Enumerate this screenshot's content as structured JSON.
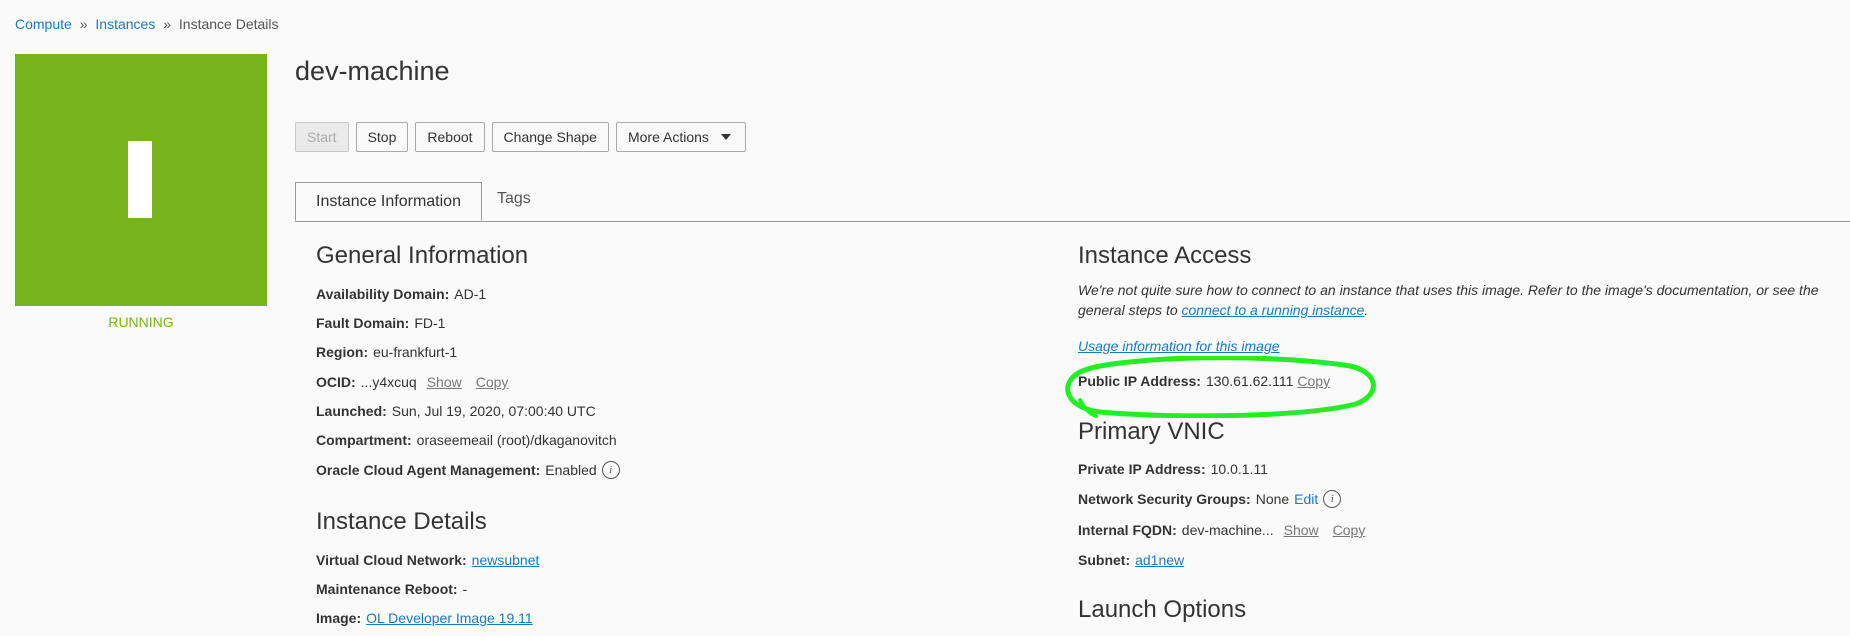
{
  "breadcrumb": {
    "items": [
      "Compute",
      "Instances",
      "Instance Details"
    ],
    "separator": "»"
  },
  "status": {
    "text": "RUNNING",
    "color": "#76b31c"
  },
  "title": "dev-machine",
  "actions": {
    "start": "Start",
    "stop": "Stop",
    "reboot": "Reboot",
    "change_shape": "Change Shape",
    "more_actions": "More Actions"
  },
  "tabs": {
    "instance_information": "Instance Information",
    "tags": "Tags"
  },
  "general": {
    "title": "General Information",
    "availability_domain": {
      "label": "Availability Domain:",
      "value": "AD-1"
    },
    "fault_domain": {
      "label": "Fault Domain:",
      "value": "FD-1"
    },
    "region": {
      "label": "Region:",
      "value": "eu-frankfurt-1"
    },
    "ocid": {
      "label": "OCID:",
      "value": "...y4xcuq",
      "show": "Show",
      "copy": "Copy"
    },
    "launched": {
      "label": "Launched:",
      "value": "Sun, Jul 19, 2020, 07:00:40 UTC"
    },
    "compartment": {
      "label": "Compartment:",
      "value": "oraseemeail (root)/dkaganovitch"
    },
    "agent": {
      "label": "Oracle Cloud Agent Management:",
      "value": "Enabled"
    }
  },
  "details": {
    "title": "Instance Details",
    "vcn": {
      "label": "Virtual Cloud Network:",
      "value": "newsubnet"
    },
    "maintenance": {
      "label": "Maintenance Reboot:",
      "value": "-"
    },
    "image": {
      "label": "Image:",
      "value": "OL Developer Image 19.11"
    }
  },
  "access": {
    "title": "Instance Access",
    "note_prefix": "We're not quite sure how to connect to an instance that uses this image. Refer to the image's documentation, or see the general steps to ",
    "note_link": "connect to a running instance",
    "note_suffix": ".",
    "usage_link": "Usage information for this image",
    "public_ip": {
      "label": "Public IP Address:",
      "value": "130.61.62.111",
      "copy": "Copy"
    }
  },
  "vnic": {
    "title": "Primary VNIC",
    "private_ip": {
      "label": "Private IP Address:",
      "value": "10.0.1.11"
    },
    "nsg": {
      "label": "Network Security Groups:",
      "value": "None",
      "edit": "Edit"
    },
    "fqdn": {
      "label": "Internal FQDN:",
      "value": "dev-machine...",
      "show": "Show",
      "copy": "Copy"
    },
    "subnet": {
      "label": "Subnet:",
      "value": "ad1new"
    }
  },
  "launch_options": {
    "title": "Launch Options"
  },
  "info_icon_glyph": "i",
  "highlight_color": "#22ee22"
}
